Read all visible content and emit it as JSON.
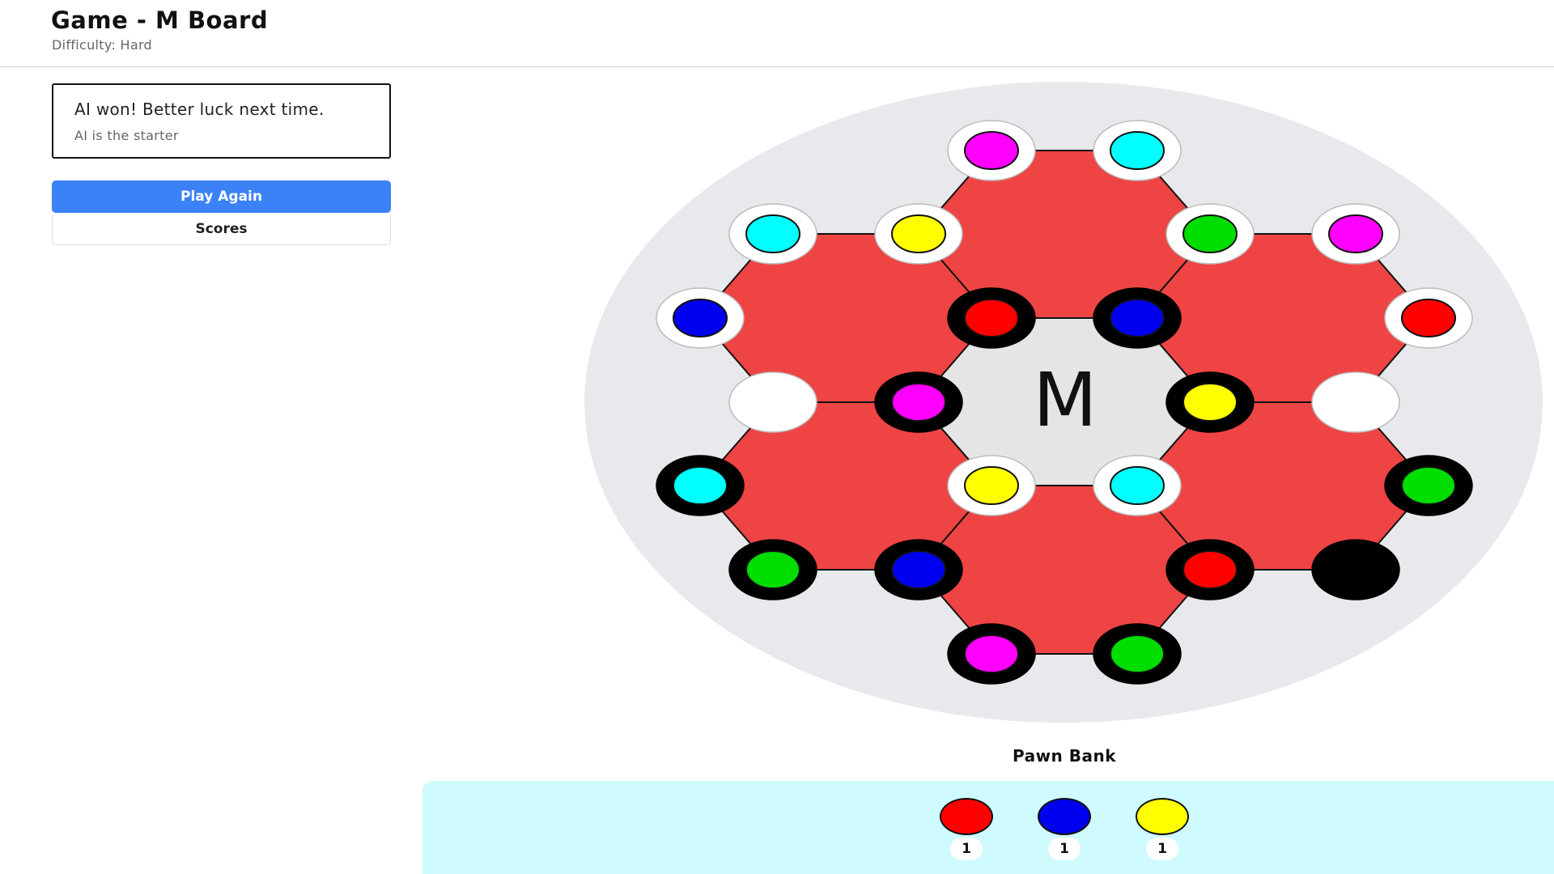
{
  "header": {
    "title": "Game - M Board",
    "subtitle": "Difficulty: Hard"
  },
  "status": {
    "message": "AI won! Better luck next time.",
    "sub": "AI is the starter"
  },
  "buttons": {
    "play_again": "Play Again",
    "scores": "Scores"
  },
  "board": {
    "center_label": "M",
    "colors": {
      "hex_fill": "#ef4444",
      "center_fill": "#e5e5e5",
      "disc_fill": "#e8e9ec",
      "red": "#ff0000",
      "blue": "#0000ee",
      "yellow": "#ffff00",
      "green": "#00dd00",
      "cyan": "#00ffff",
      "magenta": "#ff00ff"
    },
    "nodes": [
      {
        "id": "n1",
        "ring": "white",
        "pawn": "magenta"
      },
      {
        "id": "n2",
        "ring": "white",
        "pawn": "cyan"
      },
      {
        "id": "n3",
        "ring": "white",
        "pawn": "cyan"
      },
      {
        "id": "n4",
        "ring": "white",
        "pawn": "yellow"
      },
      {
        "id": "n5",
        "ring": "white",
        "pawn": "green"
      },
      {
        "id": "n6",
        "ring": "white",
        "pawn": "magenta"
      },
      {
        "id": "n7",
        "ring": "white",
        "pawn": "blue"
      },
      {
        "id": "n8",
        "ring": "black",
        "pawn": "red"
      },
      {
        "id": "n9",
        "ring": "black",
        "pawn": "blue"
      },
      {
        "id": "n10",
        "ring": "white",
        "pawn": "red"
      },
      {
        "id": "n11",
        "ring": "white",
        "pawn": null
      },
      {
        "id": "n12",
        "ring": "black",
        "pawn": "magenta"
      },
      {
        "id": "n13",
        "ring": "black",
        "pawn": "yellow"
      },
      {
        "id": "n14",
        "ring": "white",
        "pawn": null
      },
      {
        "id": "n15",
        "ring": "black",
        "pawn": "cyan"
      },
      {
        "id": "n16",
        "ring": "white",
        "pawn": "yellow"
      },
      {
        "id": "n17",
        "ring": "white",
        "pawn": "cyan"
      },
      {
        "id": "n18",
        "ring": "black",
        "pawn": "green"
      },
      {
        "id": "n19",
        "ring": "black",
        "pawn": "green"
      },
      {
        "id": "n20",
        "ring": "black",
        "pawn": "blue"
      },
      {
        "id": "n21",
        "ring": "black",
        "pawn": "red"
      },
      {
        "id": "n22",
        "ring": "black",
        "pawn": null
      },
      {
        "id": "n23",
        "ring": "black",
        "pawn": "magenta"
      },
      {
        "id": "n24",
        "ring": "black",
        "pawn": "green"
      }
    ]
  },
  "bank": {
    "title": "Pawn Bank",
    "items": [
      {
        "color": "#ff0000",
        "name": "red",
        "count": "1"
      },
      {
        "color": "#0000ee",
        "name": "blue",
        "count": "1"
      },
      {
        "color": "#ffff00",
        "name": "yellow",
        "count": "1"
      }
    ]
  }
}
